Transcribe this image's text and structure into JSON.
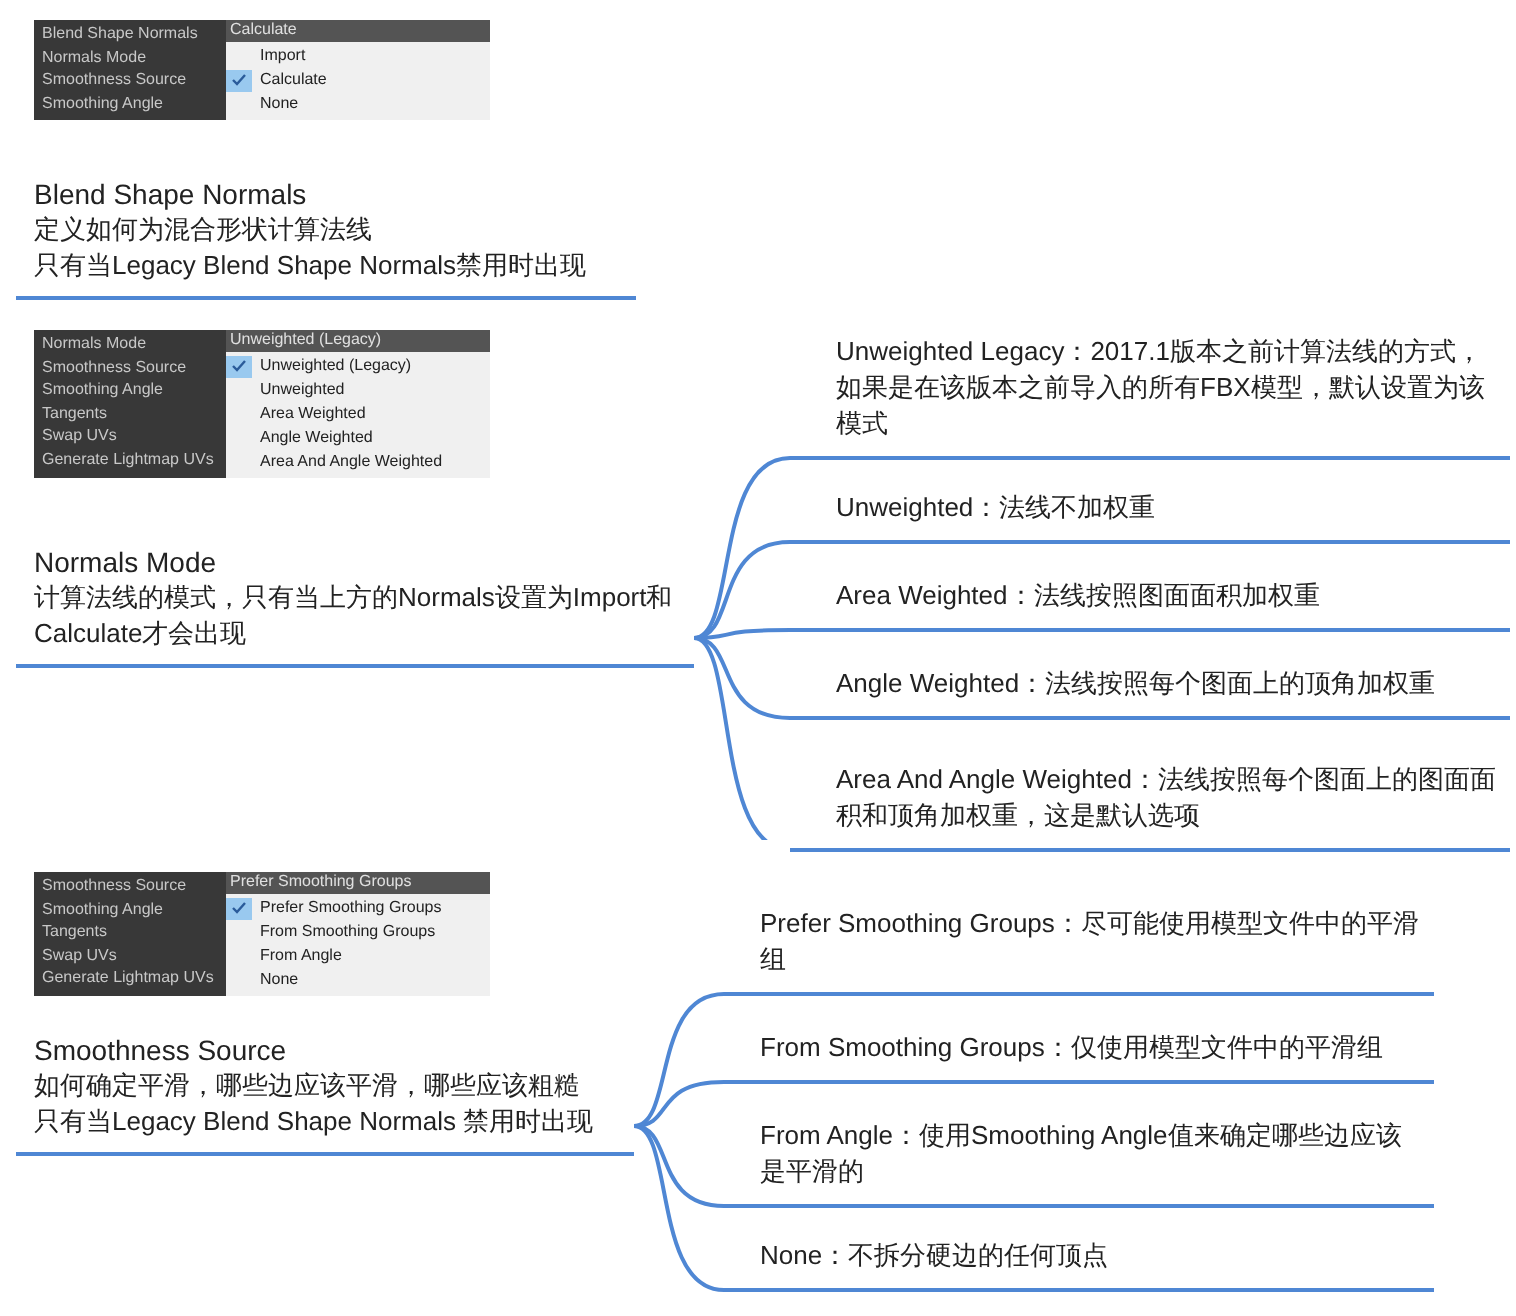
{
  "sections": [
    {
      "screenshot": {
        "labels": [
          "Blend Shape Normals",
          "Normals Mode",
          "Smoothness Source",
          "Smoothing Angle"
        ],
        "dropdown_value": "Calculate",
        "options": [
          {
            "label": "Import",
            "selected": false
          },
          {
            "label": "Calculate",
            "selected": true
          },
          {
            "label": "None",
            "selected": false
          }
        ]
      },
      "title": "Blend Shape Normals",
      "description": [
        "定义如何为混合形状计算法线",
        "只有当Legacy Blend Shape Normals禁用时出现"
      ]
    },
    {
      "screenshot": {
        "labels": [
          "Normals Mode",
          "Smoothness Source",
          "Smoothing Angle",
          "Tangents",
          "Swap UVs",
          "Generate Lightmap UVs"
        ],
        "dropdown_value": "Unweighted (Legacy)",
        "options": [
          {
            "label": "Unweighted (Legacy)",
            "selected": true
          },
          {
            "label": "Unweighted",
            "selected": false
          },
          {
            "label": "Area Weighted",
            "selected": false
          },
          {
            "label": "Angle Weighted",
            "selected": false
          },
          {
            "label": "Area And Angle Weighted",
            "selected": false
          }
        ]
      },
      "title": "Normals Mode",
      "description": [
        "计算法线的模式，只有当上方的Normals设置为Import和Calculate才会出现"
      ],
      "branches": [
        {
          "text": "Unweighted Legacy：2017.1版本之前计算法线的方式，如果是在该版本之前导入的所有FBX模型，默认设置为该模式"
        },
        {
          "text": "Unweighted：法线不加权重"
        },
        {
          "text": "Area Weighted：法线按照图面面积加权重"
        },
        {
          "text": "Angle Weighted：法线按照每个图面上的顶角加权重"
        },
        {
          "text": "Area And Angle Weighted：法线按照每个图面上的图面面积和顶角加权重，这是默认选项"
        }
      ]
    },
    {
      "screenshot": {
        "labels": [
          "Smoothness Source",
          "Smoothing Angle",
          "Tangents",
          "Swap UVs",
          "Generate Lightmap UVs"
        ],
        "dropdown_value": "Prefer Smoothing Groups",
        "options": [
          {
            "label": "Prefer Smoothing Groups",
            "selected": true
          },
          {
            "label": "From Smoothing Groups",
            "selected": false
          },
          {
            "label": "From Angle",
            "selected": false
          },
          {
            "label": "None",
            "selected": false
          }
        ]
      },
      "title": "Smoothness Source",
      "description": [
        "如何确定平滑，哪些边应该平滑，哪些应该粗糙",
        "只有当Legacy Blend Shape Normals 禁用时出现"
      ],
      "branches": [
        {
          "text": "Prefer Smoothing Groups：尽可能使用模型文件中的平滑组"
        },
        {
          "text": "From Smoothing Groups：仅使用模型文件中的平滑组"
        },
        {
          "text": "From Angle：使用Smoothing Angle值来确定哪些边应该是平滑的"
        },
        {
          "text": "None：不拆分硬边的任何顶点"
        }
      ]
    }
  ]
}
